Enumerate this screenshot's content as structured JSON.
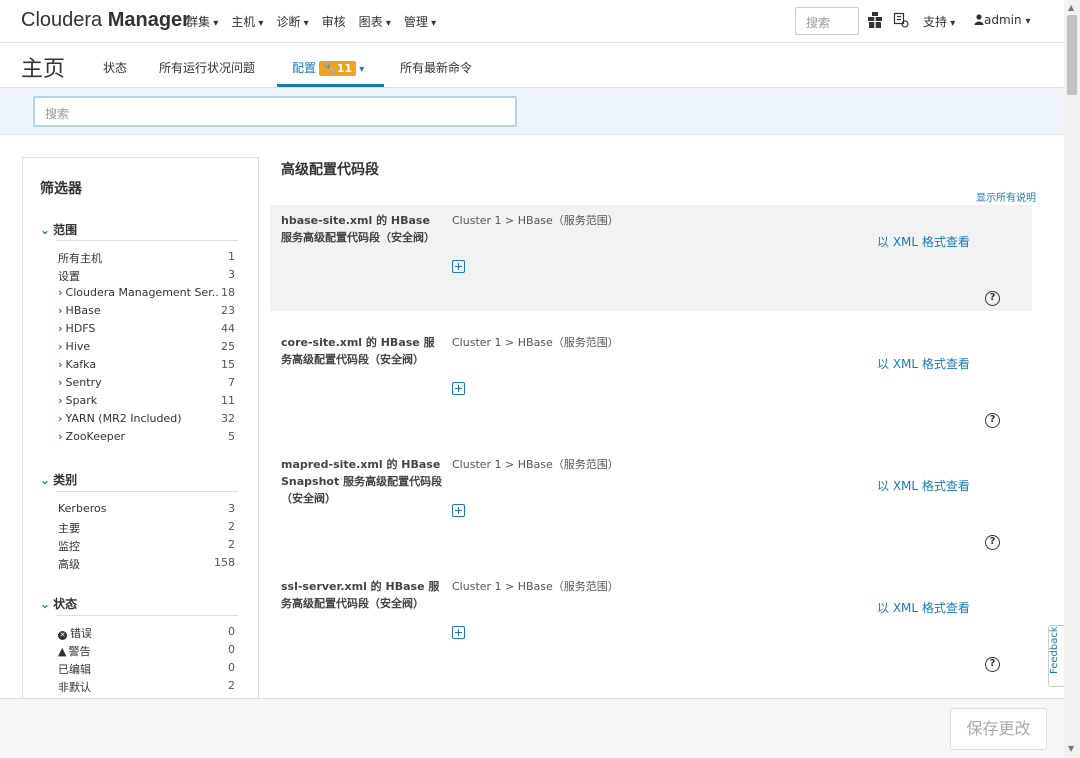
{
  "app": {
    "brand_light": "Cloudera ",
    "brand_bold": "Manager"
  },
  "topnav": {
    "items": [
      "群集",
      "主机",
      "诊断",
      "审核",
      "图表",
      "管理"
    ],
    "search_placeholder": "搜索",
    "support": "支持",
    "user": "admin"
  },
  "subhead": {
    "title": "主页",
    "tabs": [
      "状态",
      "所有运行状况问题",
      "配置",
      "所有最新命令"
    ],
    "config_badge": "11"
  },
  "search": {
    "placeholder": "搜索"
  },
  "filter": {
    "title": "筛选器",
    "scope": {
      "heading": "范围",
      "items": [
        {
          "label": "所有主机",
          "count": "1"
        },
        {
          "label": "设置",
          "count": "3"
        },
        {
          "label": "Cloudera Management Ser...",
          "count": "18"
        },
        {
          "label": "HBase",
          "count": "23"
        },
        {
          "label": "HDFS",
          "count": "44"
        },
        {
          "label": "Hive",
          "count": "25"
        },
        {
          "label": "Kafka",
          "count": "15"
        },
        {
          "label": "Sentry",
          "count": "7"
        },
        {
          "label": "Spark",
          "count": "11"
        },
        {
          "label": "YARN (MR2 Included)",
          "count": "32"
        },
        {
          "label": "ZooKeeper",
          "count": "5"
        }
      ]
    },
    "category": {
      "heading": "类别",
      "items": [
        {
          "label": "Kerberos",
          "count": "3"
        },
        {
          "label": "主要",
          "count": "2"
        },
        {
          "label": "监控",
          "count": "2"
        },
        {
          "label": "高级",
          "count": "158"
        }
      ]
    },
    "status": {
      "heading": "状态",
      "items": [
        {
          "label": "错误",
          "count": "0"
        },
        {
          "label": "警告",
          "count": "0"
        },
        {
          "label": "已编辑",
          "count": "0"
        },
        {
          "label": "非默认",
          "count": "2"
        }
      ]
    }
  },
  "main": {
    "section_title": "高级配置代码段",
    "show_all": "显示所有说明",
    "view_xml": "以 XML 格式查看",
    "configs": [
      {
        "name": "hbase-site.xml 的 HBase 服务高级配置代码段（安全阀）",
        "scope": "Cluster 1 > HBase（服务范围）"
      },
      {
        "name": "core-site.xml 的 HBase 服务高级配置代码段（安全阀）",
        "scope": "Cluster 1 > HBase（服务范围）"
      },
      {
        "name": "mapred-site.xml 的 HBase Snapshot 服务高级配置代码段（安全阀）",
        "scope": "Cluster 1 > HBase（服务范围）"
      },
      {
        "name": "ssl-server.xml 的 HBase 服务高级配置代码段（安全阀）",
        "scope": "Cluster 1 > HBase（服务范围）"
      }
    ]
  },
  "footer": {
    "save": "保存更改"
  },
  "feedback": "Feedback",
  "colors": {
    "accent": "#1a7bb9",
    "badge": "#f0a31f"
  }
}
